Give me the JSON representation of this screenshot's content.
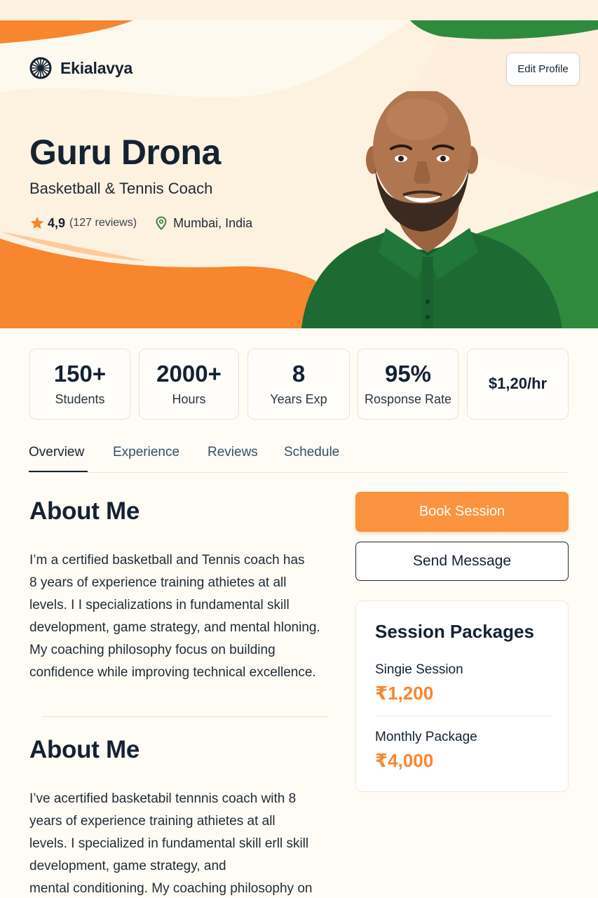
{
  "brand": {
    "name": "Ekialavya",
    "icon": "chakra-logo-icon"
  },
  "header": {
    "edit_profile_label": "Edit Profile"
  },
  "profile": {
    "name": "Guru Drona",
    "title": "Basketball & Tennis Coach",
    "rating": "4,9",
    "reviews": "(127 reviews)",
    "location": "Mumbai, India",
    "photo_icon": "coach-portrait"
  },
  "stats": [
    {
      "value": "150+",
      "label": "Students"
    },
    {
      "value": "2000+",
      "label": "Hours"
    },
    {
      "value": "8",
      "label": "Years Exp"
    },
    {
      "value": "95%",
      "label": "Rosponse Rate"
    },
    {
      "value": "$1,20/hr",
      "label": ""
    }
  ],
  "tabs": [
    {
      "label": "Overview",
      "active": true
    },
    {
      "label": "Experience",
      "active": false
    },
    {
      "label": "Reviews",
      "active": false
    },
    {
      "label": "Schedule",
      "active": false
    }
  ],
  "about": [
    {
      "title": "About Me",
      "lines": [
        "I’m a certified basketball and Tennis coach has",
        "8 years of experience training athietes at all",
        "levels. I I specializations in fundamental skill",
        "development, game strategy, and mental hloning.",
        "My coaching philosophy focus on building",
        "confidence while improving technical excellence."
      ]
    },
    {
      "title": "About Me",
      "lines": [
        "I’ve acertified basketabil tennnis coach with 8",
        "years of experience training athietes at all",
        "levels. I specialized in fundamental skill erll skill",
        "development, game strategy, and",
        "mental conditioning. My coaching philosophy on"
      ]
    }
  ],
  "actions": {
    "book_label": "Book Session",
    "message_label": "Send Message"
  },
  "packages": {
    "title": "Session Packages",
    "items": [
      {
        "name": "Singie Session",
        "price": "₹1,200"
      },
      {
        "name": "Monthly Package",
        "price": "₹4,000"
      }
    ]
  },
  "colors": {
    "saffron": "#f7862e",
    "green": "#2f8a3e",
    "navy": "#142232",
    "cream": "#fefcf4"
  }
}
